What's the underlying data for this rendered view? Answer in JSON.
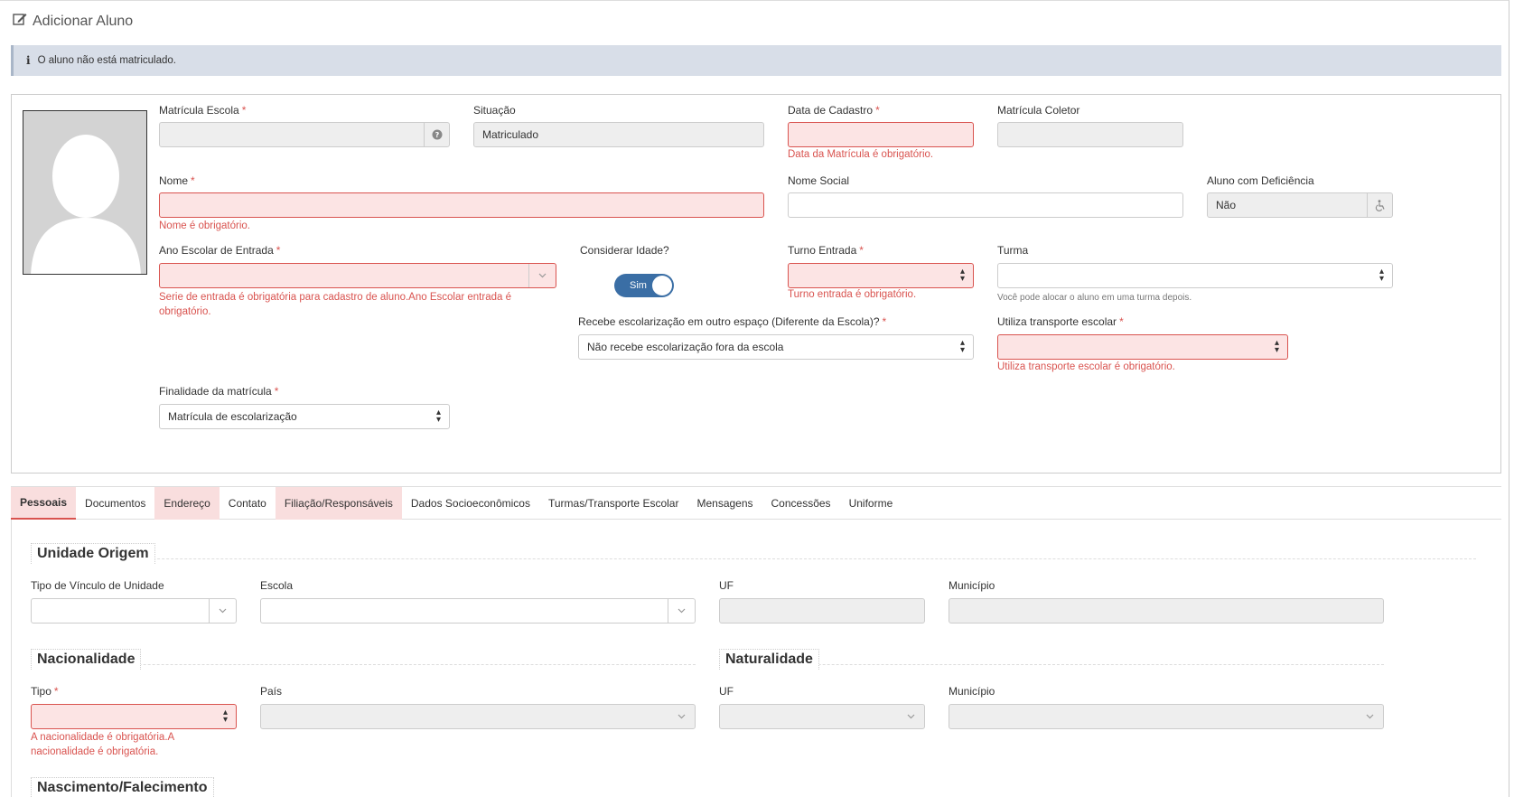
{
  "page": {
    "title": "Adicionar Aluno"
  },
  "alert": {
    "text": "O aluno não está matriculado."
  },
  "form": {
    "matricula_escola": {
      "label": "Matrícula Escola",
      "value": ""
    },
    "situacao": {
      "label": "Situação",
      "value": "Matriculado"
    },
    "data_cadastro": {
      "label": "Data de Cadastro",
      "value": "",
      "error": "Data da Matrícula é obrigatório."
    },
    "matricula_coletor": {
      "label": "Matrícula Coletor",
      "value": ""
    },
    "nome": {
      "label": "Nome",
      "value": "",
      "error": "Nome é obrigatório."
    },
    "nome_social": {
      "label": "Nome Social",
      "value": ""
    },
    "deficiencia": {
      "label": "Aluno com Deficiência",
      "value": "Não"
    },
    "ano_escolar": {
      "label": "Ano Escolar de Entrada",
      "value": "",
      "error": "Serie de entrada é obrigatória para cadastro de aluno.Ano Escolar entrada é obrigatório."
    },
    "considerar_idade": {
      "label": "Considerar Idade?",
      "value": "Sim"
    },
    "turno_entrada": {
      "label": "Turno Entrada",
      "value": "",
      "error": "Turno entrada é obrigatório."
    },
    "turma": {
      "label": "Turma",
      "value": "",
      "hint": "Você pode alocar o aluno em uma turma depois."
    },
    "escolarizacao": {
      "label": "Recebe escolarização em outro espaço (Diferente da Escola)?",
      "value": "Não recebe escolarização fora da escola"
    },
    "transporte": {
      "label": "Utiliza transporte escolar",
      "value": "",
      "error": "Utiliza transporte escolar é obrigatório."
    },
    "finalidade": {
      "label": "Finalidade da matrícula",
      "value": "Matrícula de escolarização"
    }
  },
  "tabs": [
    {
      "label": "Pessoais",
      "active": true,
      "error": true
    },
    {
      "label": "Documentos",
      "active": false,
      "error": false
    },
    {
      "label": "Endereço",
      "active": false,
      "error": true
    },
    {
      "label": "Contato",
      "active": false,
      "error": false
    },
    {
      "label": "Filiação/Responsáveis",
      "active": false,
      "error": true
    },
    {
      "label": "Dados Socioeconômicos",
      "active": false,
      "error": false
    },
    {
      "label": "Turmas/Transporte Escolar",
      "active": false,
      "error": false
    },
    {
      "label": "Mensagens",
      "active": false,
      "error": false
    },
    {
      "label": "Concessões",
      "active": false,
      "error": false
    },
    {
      "label": "Uniforme",
      "active": false,
      "error": false
    }
  ],
  "unidade_origem": {
    "title": "Unidade Origem",
    "tipo_vinculo": {
      "label": "Tipo de Vínculo de Unidade",
      "value": ""
    },
    "escola": {
      "label": "Escola",
      "value": ""
    },
    "uf": {
      "label": "UF",
      "value": ""
    },
    "municipio": {
      "label": "Município",
      "value": ""
    }
  },
  "nacionalidade": {
    "title": "Nacionalidade",
    "tipo": {
      "label": "Tipo",
      "value": "",
      "error": "A nacionalidade é obrigatória.A nacionalidade é obrigatória."
    },
    "pais": {
      "label": "País",
      "value": ""
    }
  },
  "naturalidade": {
    "title": "Naturalidade",
    "uf": {
      "label": "UF",
      "value": ""
    },
    "municipio": {
      "label": "Município",
      "value": ""
    }
  },
  "nascimento": {
    "title": "Nascimento/Falecimento"
  },
  "required_mark": "*"
}
